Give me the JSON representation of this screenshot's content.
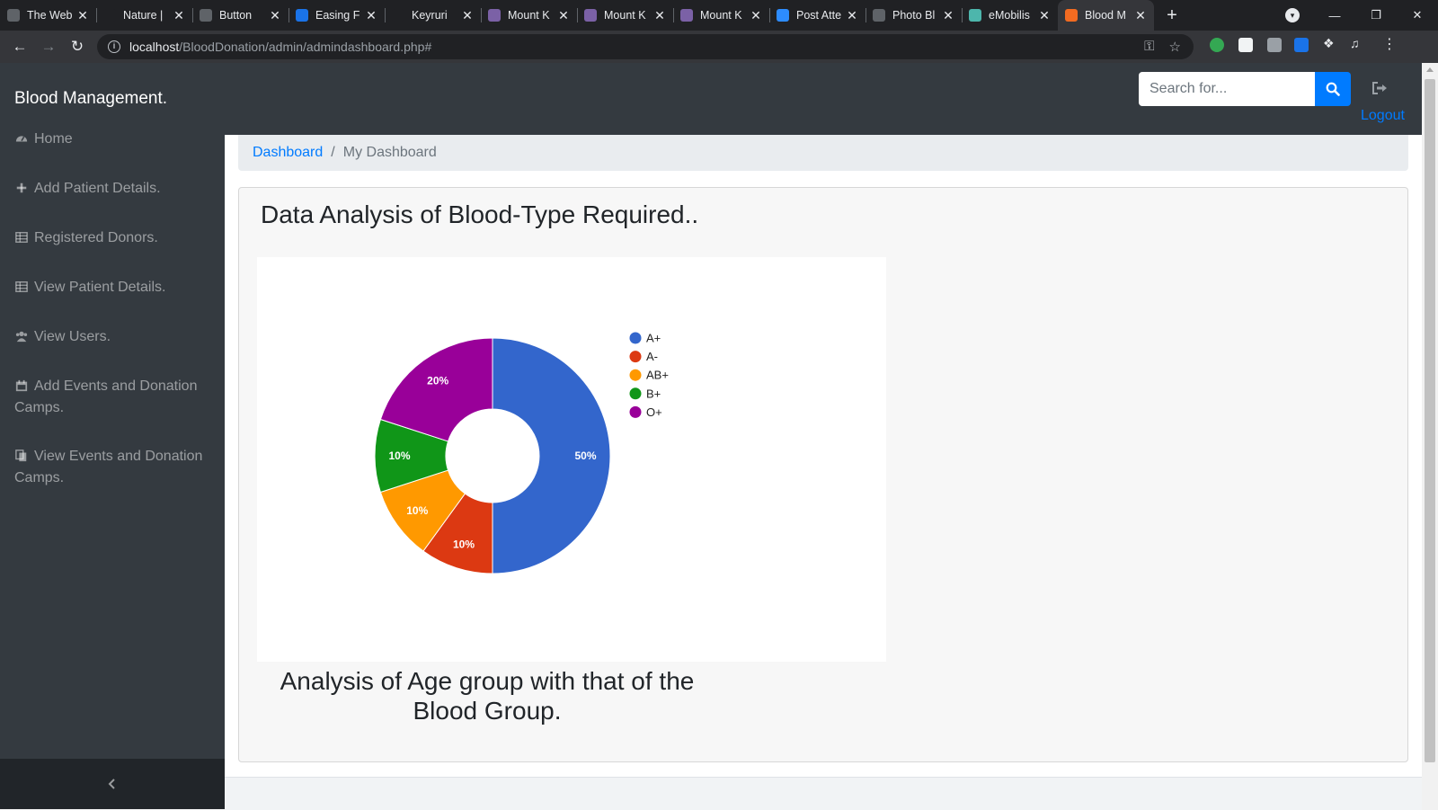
{
  "browser": {
    "tabs": [
      {
        "title": "The Web",
        "favicon_color": "#5f6368"
      },
      {
        "title": "Nature |",
        "favicon_color": "#202124"
      },
      {
        "title": "Button",
        "favicon_color": "#5f6368"
      },
      {
        "title": "Easing F",
        "favicon_color": "#1a73e8"
      },
      {
        "title": "Keyruri",
        "favicon_color": "#202124"
      },
      {
        "title": "Mount K",
        "favicon_color": "#7b61a6"
      },
      {
        "title": "Mount K",
        "favicon_color": "#7b61a6"
      },
      {
        "title": "Mount K",
        "favicon_color": "#7b61a6"
      },
      {
        "title": "Post Atte",
        "favicon_color": "#2d8cff"
      },
      {
        "title": "Photo Bl",
        "favicon_color": "#5f6368"
      },
      {
        "title": "eMobilis",
        "favicon_color": "#4db6ac"
      },
      {
        "title": "Blood M",
        "favicon_color": "#f26b21"
      }
    ],
    "url_host": "localhost",
    "url_path": "/BloodDonation/admin/admindashboard.php#"
  },
  "app": {
    "brand": "Blood Management.",
    "search_placeholder": "Search for...",
    "logout": "Logout"
  },
  "sidebar": {
    "items": [
      {
        "label": "Home",
        "icon": "dashboard-icon"
      },
      {
        "label": "Add Patient Details.",
        "icon": "plus-icon"
      },
      {
        "label": "Registered Donors.",
        "icon": "table-icon"
      },
      {
        "label": "View Patient Details.",
        "icon": "table-icon"
      },
      {
        "label": "View Users.",
        "icon": "users-icon"
      },
      {
        "label": "Add Events and Donation Camps.",
        "icon": "calendar-icon"
      },
      {
        "label": "View Events and Donation Camps.",
        "icon": "copy-icon"
      }
    ]
  },
  "breadcrumb": {
    "link": "Dashboard",
    "separator": "/",
    "current": "My Dashboard"
  },
  "card": {
    "title": "Data Analysis of Blood-Type Required..",
    "subtitle": "Analysis of Age group with that of the Blood Group."
  },
  "chart_data": {
    "type": "pie",
    "donut": true,
    "categories": [
      "A+",
      "A-",
      "AB+",
      "B+",
      "O+"
    ],
    "values": [
      50,
      10,
      10,
      10,
      20
    ],
    "labels": [
      "50%",
      "10%",
      "10%",
      "10%",
      "20%"
    ],
    "colors": [
      "#3366cc",
      "#dc3912",
      "#ff9900",
      "#109618",
      "#990099"
    ],
    "legend": "right"
  }
}
